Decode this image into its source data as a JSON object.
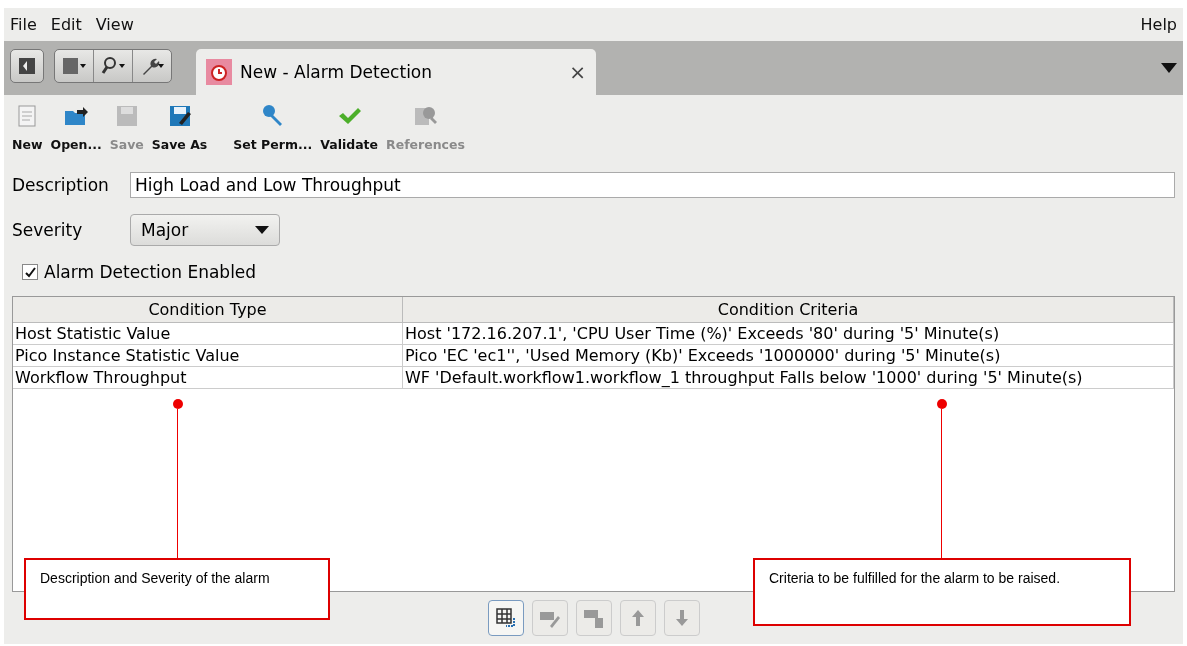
{
  "menu": {
    "left": [
      "File",
      "Edit",
      "View"
    ],
    "right": [
      "Help"
    ]
  },
  "perspective_buttons": [
    {
      "kind": "perspective"
    }
  ],
  "tool_buttons": [
    {
      "kind": "document"
    },
    {
      "kind": "search"
    },
    {
      "kind": "wrench"
    }
  ],
  "tabs": [
    {
      "label": "New - Alarm Detection",
      "selected": true,
      "close": "×"
    }
  ],
  "toolbar": [
    {
      "kind": "new",
      "label": "New",
      "disabled": false
    },
    {
      "kind": "open",
      "label": "Open...",
      "disabled": false
    },
    {
      "kind": "save",
      "label": "Save",
      "disabled": true
    },
    {
      "kind": "saveas",
      "label": "Save As",
      "disabled": false
    },
    {
      "kind": "perm",
      "label": "Set Perm...",
      "disabled": false
    },
    {
      "kind": "validate",
      "label": "Validate",
      "disabled": false
    },
    {
      "kind": "refs",
      "label": "References",
      "disabled": true
    }
  ],
  "description": {
    "label": "Description",
    "value": "High Load and Low Throughput"
  },
  "severity": {
    "label": "Severity",
    "value": "Major"
  },
  "enabled_checkbox": {
    "label": "Alarm Detection Enabled",
    "checked": true
  },
  "table": {
    "columns": [
      "Condition Type",
      "Condition Criteria"
    ],
    "rows": [
      [
        "Host Statistic Value",
        "Host '172.16.207.1', 'CPU User Time (%)' Exceeds '80' during '5' Minute(s)"
      ],
      [
        "Pico Instance Statistic Value",
        "Pico 'EC 'ec1'', 'Used Memory (Kb)' Exceeds '1000000' during '5' Minute(s)"
      ],
      [
        "Workflow Throughput",
        "WF 'Default.workflow1.workflow_1 throughput Falls below '1000' during '5' Minute(s)"
      ]
    ]
  },
  "row_buttons": [
    {
      "kind": "add",
      "disabled": false
    },
    {
      "kind": "edit",
      "disabled": true
    },
    {
      "kind": "delete",
      "disabled": true
    },
    {
      "kind": "up",
      "disabled": true
    },
    {
      "kind": "down",
      "disabled": true
    }
  ],
  "annotations": [
    {
      "text": "Description and Severity of the alarm"
    },
    {
      "text": "Criteria to be fulfilled for the alarm to be raised."
    }
  ]
}
